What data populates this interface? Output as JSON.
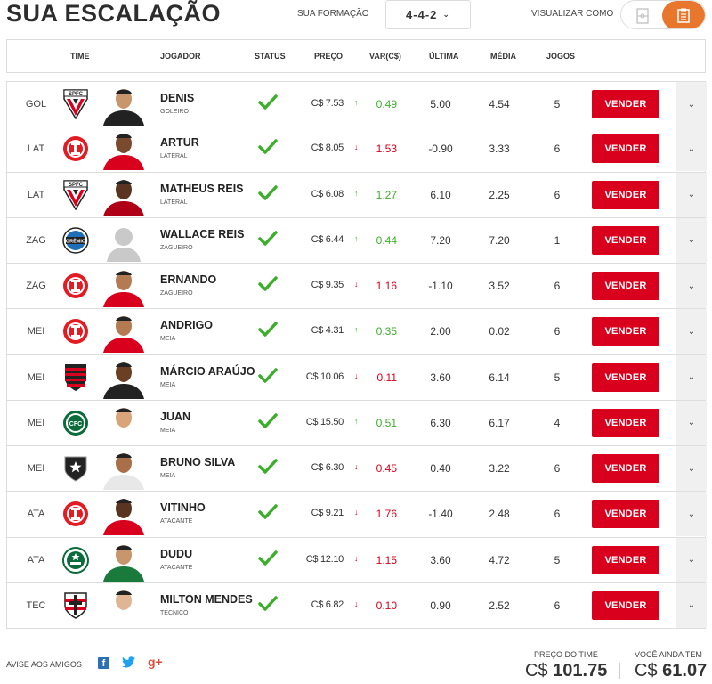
{
  "header": {
    "title": "SUA ESCALAÇÃO",
    "formation_label": "SUA FORMAÇÃO",
    "formation_value": "4-4-2",
    "view_label": "VISUALIZAR COMO"
  },
  "columns": {
    "team": "TIME",
    "player": "JOGADOR",
    "status": "STATUS",
    "price": "PREÇO",
    "var": "VAR(C$)",
    "last": "ÚLTIMA",
    "avg": "MÉDIA",
    "games": "JOGOS"
  },
  "sell_label": "VENDER",
  "colors": {
    "accent": "#d8001c",
    "up": "#3dae2b",
    "down": "#d8001c",
    "toggle_active": "#e8762c"
  },
  "players": [
    {
      "pos": "GOL",
      "club": "sao-paulo",
      "name": "DENIS",
      "role": "GOLEIRO",
      "price": "C$ 7.53",
      "trend": "up",
      "var": "0.49",
      "last": "5.00",
      "avg": "4.54",
      "games": "5"
    },
    {
      "pos": "LAT",
      "club": "internacional",
      "name": "ARTUR",
      "role": "LATERAL",
      "price": "C$ 8.05",
      "trend": "down",
      "var": "1.53",
      "last": "-0.90",
      "avg": "3.33",
      "games": "6"
    },
    {
      "pos": "LAT",
      "club": "sao-paulo",
      "name": "MATHEUS REIS",
      "role": "LATERAL",
      "price": "C$ 6.08",
      "trend": "up",
      "var": "1.27",
      "last": "6.10",
      "avg": "2.25",
      "games": "6"
    },
    {
      "pos": "ZAG",
      "club": "gremio",
      "name": "WALLACE REIS",
      "role": "ZAGUEIRO",
      "price": "C$ 6.44",
      "trend": "up",
      "var": "0.44",
      "last": "7.20",
      "avg": "7.20",
      "games": "1"
    },
    {
      "pos": "ZAG",
      "club": "internacional",
      "name": "ERNANDO",
      "role": "ZAGUEIRO",
      "price": "C$ 9.35",
      "trend": "down",
      "var": "1.16",
      "last": "-1.10",
      "avg": "3.52",
      "games": "6"
    },
    {
      "pos": "MEI",
      "club": "internacional",
      "name": "ANDRIGO",
      "role": "MEIA",
      "price": "C$ 4.31",
      "trend": "up",
      "var": "0.35",
      "last": "2.00",
      "avg": "0.02",
      "games": "6"
    },
    {
      "pos": "MEI",
      "club": "flamengo",
      "name": "MÁRCIO ARAÚJO",
      "role": "MEIA",
      "price": "C$ 10.06",
      "trend": "down",
      "var": "0.11",
      "last": "3.60",
      "avg": "6.14",
      "games": "5"
    },
    {
      "pos": "MEI",
      "club": "coritiba",
      "name": "JUAN",
      "role": "MEIA",
      "price": "C$ 15.50",
      "trend": "up",
      "var": "0.51",
      "last": "6.30",
      "avg": "6.17",
      "games": "4"
    },
    {
      "pos": "MEI",
      "club": "botafogo",
      "name": "BRUNO SILVA",
      "role": "MEIA",
      "price": "C$ 6.30",
      "trend": "down",
      "var": "0.45",
      "last": "0.40",
      "avg": "3.22",
      "games": "6"
    },
    {
      "pos": "ATA",
      "club": "internacional",
      "name": "VITINHO",
      "role": "ATACANTE",
      "price": "C$ 9.21",
      "trend": "down",
      "var": "1.76",
      "last": "-1.40",
      "avg": "2.48",
      "games": "6"
    },
    {
      "pos": "ATA",
      "club": "palmeiras",
      "name": "DUDU",
      "role": "ATACANTE",
      "price": "C$ 12.10",
      "trend": "down",
      "var": "1.15",
      "last": "3.60",
      "avg": "4.72",
      "games": "5"
    },
    {
      "pos": "TEC",
      "club": "santa-cruz",
      "name": "MILTON MENDES",
      "role": "TÉCNICO",
      "price": "C$ 6.82",
      "trend": "down",
      "var": "0.10",
      "last": "0.90",
      "avg": "2.52",
      "games": "6"
    }
  ],
  "footer": {
    "share_label": "AVISE AOS AMIGOS",
    "team_price_label": "PREÇO DO TIME",
    "team_price_currency": "C$",
    "team_price_value": "101.75",
    "remaining_label": "VOCÊ AINDA TEM",
    "remaining_currency": "C$",
    "remaining_value": "61.07"
  }
}
